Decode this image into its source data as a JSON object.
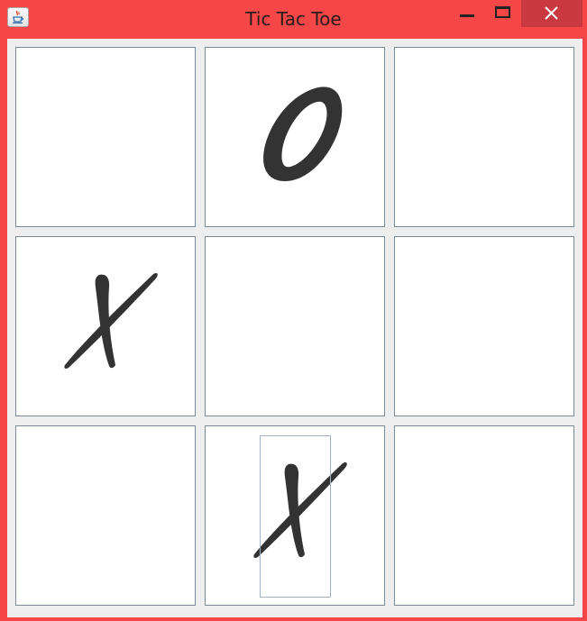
{
  "window": {
    "title": "Tic Tac Toe",
    "app_icon": "java-cup-icon",
    "controls": [
      "minimize-icon",
      "maximize-icon",
      "close-icon"
    ],
    "frame_color": "#f54747",
    "close_hover_color": "#c9393f"
  },
  "board": {
    "background": "#eeeeee",
    "cell_border_color": "#7a8a99",
    "mark_color": "#333333",
    "cells": [
      {
        "value": ""
      },
      {
        "value": "O"
      },
      {
        "value": ""
      },
      {
        "value": "X"
      },
      {
        "value": ""
      },
      {
        "value": ""
      },
      {
        "value": ""
      },
      {
        "value": "X",
        "focused": true
      },
      {
        "value": ""
      }
    ]
  }
}
